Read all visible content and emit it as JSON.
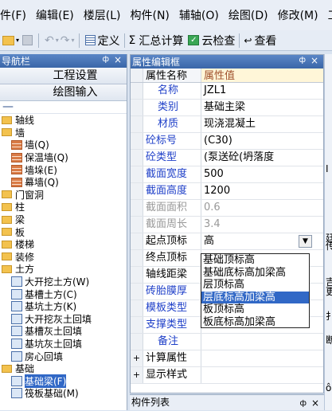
{
  "menu": [
    "件(F)",
    "编辑(E)",
    "楼层(L)",
    "构件(N)",
    "辅轴(O)",
    "绘图(D)",
    "修改(M)",
    "工"
  ],
  "toolbar": {
    "define": "定义",
    "sum_icon": "Σ",
    "summary": "汇总计算",
    "cloud_check": "云检查",
    "view": "查看"
  },
  "nav": {
    "title": "导航栏",
    "pin": "ф",
    "close": "×",
    "buttons": [
      "工程设置",
      "绘图输入"
    ],
    "collapse": "—",
    "tree": [
      {
        "label": "轴线",
        "level": 0,
        "type": "folder"
      },
      {
        "label": "墙",
        "level": 0,
        "type": "folder"
      },
      {
        "label": "墙(Q)",
        "level": 1,
        "type": "wall"
      },
      {
        "label": "保温墙(Q)",
        "level": 1,
        "type": "wall"
      },
      {
        "label": "墙垛(E)",
        "level": 1,
        "type": "wall"
      },
      {
        "label": "幕墙(Q)",
        "level": 1,
        "type": "wall"
      },
      {
        "label": "门窗洞",
        "level": 0,
        "type": "folder"
      },
      {
        "label": "柱",
        "level": 0,
        "type": "folder"
      },
      {
        "label": "梁",
        "level": 0,
        "type": "folder"
      },
      {
        "label": "板",
        "level": 0,
        "type": "folder"
      },
      {
        "label": "楼梯",
        "level": 0,
        "type": "folder"
      },
      {
        "label": "装修",
        "level": 0,
        "type": "folder"
      },
      {
        "label": "土方",
        "level": 0,
        "type": "folder"
      },
      {
        "label": "大开挖土方(W)",
        "level": 1,
        "type": "leaf"
      },
      {
        "label": "基槽土方(C)",
        "level": 1,
        "type": "leaf"
      },
      {
        "label": "基坑土方(K)",
        "level": 1,
        "type": "leaf"
      },
      {
        "label": "大开挖灰土回填",
        "level": 1,
        "type": "leaf"
      },
      {
        "label": "基槽灰土回填",
        "level": 1,
        "type": "leaf"
      },
      {
        "label": "基坑灰土回填",
        "level": 1,
        "type": "leaf"
      },
      {
        "label": "房心回填",
        "level": 1,
        "type": "leaf"
      },
      {
        "label": "基础",
        "level": 0,
        "type": "folder"
      },
      {
        "label": "基础梁(F)",
        "level": 1,
        "type": "leaf",
        "selected": true
      },
      {
        "label": "筏板基础(M)",
        "level": 1,
        "type": "leaf"
      }
    ]
  },
  "props": {
    "title": "属性编辑框",
    "pin": "ф",
    "close": "×",
    "header": {
      "name": "属性名称",
      "value": "属性值"
    },
    "rows": [
      {
        "name": "名称",
        "value": "JZL1",
        "blue": true
      },
      {
        "name": "类别",
        "value": "基础主梁",
        "blue": true
      },
      {
        "name": "材质",
        "value": "现浇混凝土",
        "blue": true
      },
      {
        "name": "砼标号",
        "value": "(C30)",
        "blue": true
      },
      {
        "name": "砼类型",
        "value": "(泵送砼(坍落度",
        "blue": true
      },
      {
        "name": "截面宽度",
        "value": "500",
        "blue": true
      },
      {
        "name": "截面高度",
        "value": "1200",
        "blue": true
      },
      {
        "name": "截面面积",
        "value": "0.6",
        "gray": true
      },
      {
        "name": "截面周长",
        "value": "3.4",
        "gray": true
      },
      {
        "name": "起点顶标",
        "value": "高",
        "combo": true
      },
      {
        "name": "终点顶标",
        "value": ""
      },
      {
        "name": "轴线距梁",
        "value": ""
      },
      {
        "name": "砖胎膜厚",
        "value": "",
        "blue": true
      },
      {
        "name": "模板类型",
        "value": "",
        "blue": true
      },
      {
        "name": "支撑类型",
        "value": "",
        "blue": true
      },
      {
        "name": "备注",
        "value": "",
        "blue": true
      },
      {
        "name": "计算属性",
        "value": "",
        "expand": "+"
      },
      {
        "name": "显示样式",
        "value": "",
        "expand": "+"
      }
    ],
    "dropdown": [
      "基础顶标高",
      "基础底标高加梁高",
      "层顶标高",
      "层底标高加梁高",
      "板顶标高",
      "板底标高加梁高"
    ],
    "dropdown_selected": 3,
    "combo_arrow": "▼"
  },
  "bottom_panel": {
    "title": "构件列表",
    "pin": "ф",
    "close": "×"
  },
  "right_strip": [
    "I",
    "廷",
    "传",
    "吉",
    "更",
    "扌",
    "断",
    "ô"
  ]
}
